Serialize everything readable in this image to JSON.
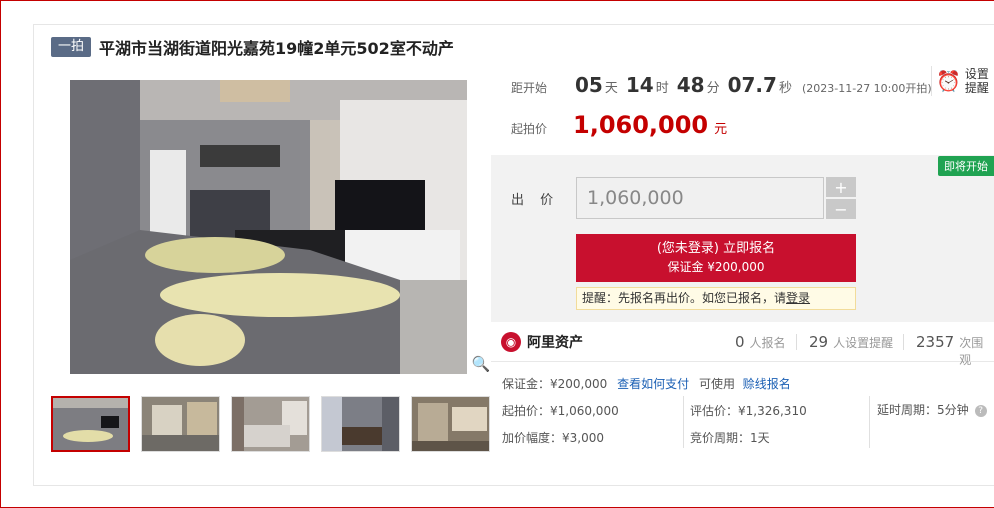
{
  "title": {
    "tag": "一拍",
    "text": "平湖市当湖街道阳光嘉苑19幢2单元502室不动产"
  },
  "countdown": {
    "label": "距开始",
    "days": "05",
    "days_unit": "天",
    "hours": "14",
    "hours_unit": "时",
    "minutes": "48",
    "minutes_unit": "分",
    "seconds": "07.7",
    "seconds_unit": "秒",
    "start_note": "(2023-11-27 10:00开拍)"
  },
  "remind": {
    "icon": "alarm-clock-icon",
    "label": "设置提醒"
  },
  "start_price": {
    "label": "起拍价",
    "value": "1,060,000",
    "unit": "元"
  },
  "bid": {
    "status_badge": "即将开始",
    "label": "出 价",
    "input_value": "1,060,000",
    "plus": "+",
    "minus": "−",
    "signup_line1": "(您未登录) 立即报名",
    "signup_line2": "保证金 ¥200,000",
    "notice_text": "提醒：先报名再出价。如您已报名，请",
    "notice_link": "登录"
  },
  "stats": {
    "brand": "阿里资产",
    "brand_icon": "ali-assets-logo-icon",
    "signups_num": "0",
    "signups_label": "人报名",
    "reminders_num": "29",
    "reminders_label": "人设置提醒",
    "views_num": "2357",
    "views_label": "次围观"
  },
  "details": {
    "deposit": "保证金：¥200,000",
    "how_to_pay": "查看如何支付",
    "available": "可使用",
    "credit_signup": "赊线报名",
    "start_price": "起拍价：¥1,060,000",
    "appraisal": "评估价：¥1,326,310",
    "delay_period": "延时周期：5分钟",
    "increment": "加价幅度：¥3,000",
    "auction_period": "竞价周期：1天"
  },
  "colors": {
    "accent_red": "#c8102e",
    "price_red": "#c40000",
    "tag_blue": "#5a6b86",
    "badge_green": "#20a352",
    "link_blue": "#1a5fb4"
  }
}
